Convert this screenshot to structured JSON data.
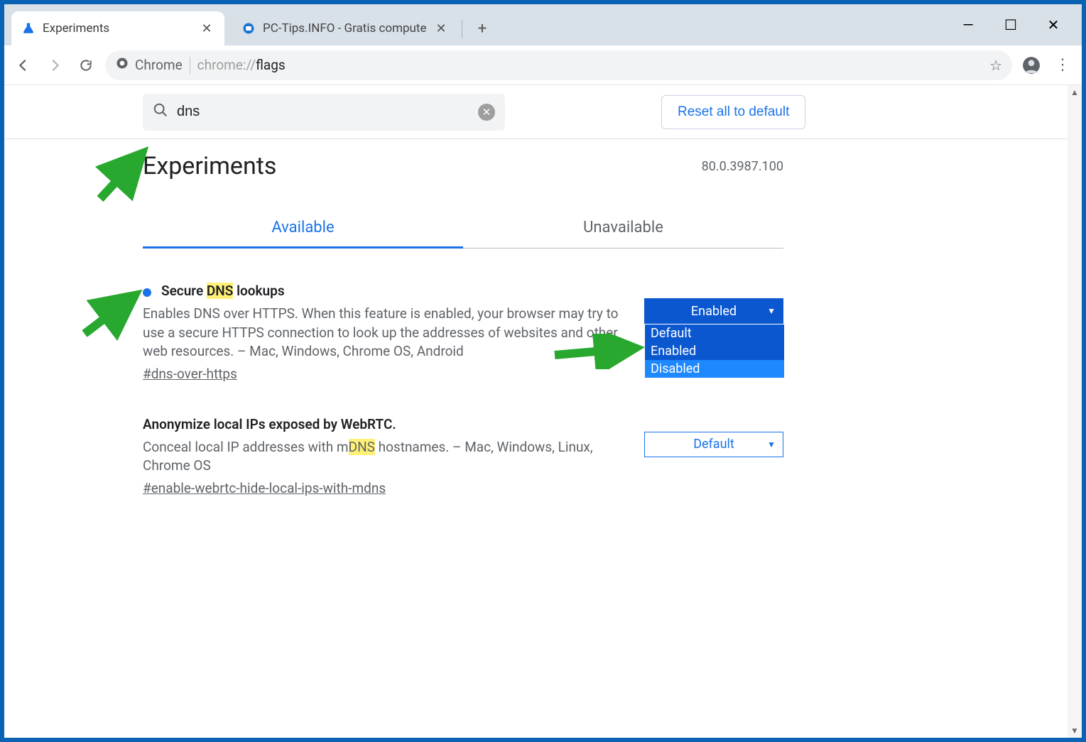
{
  "window": {
    "minimize_tip": "Minimize",
    "maximize_tip": "Maximize",
    "close_tip": "Close"
  },
  "tabs": [
    {
      "title": "Experiments",
      "active": true
    },
    {
      "title": "PC-Tips.INFO - Gratis computer t",
      "active": false
    }
  ],
  "toolbar": {
    "chip_label": "Chrome",
    "url_prefix": "chrome://",
    "url_suffix": "flags"
  },
  "flags": {
    "search_value": "dns",
    "reset_label": "Reset all to default",
    "heading": "Experiments",
    "version": "80.0.3987.100",
    "tab_available": "Available",
    "tab_unavailable": "Unavailable",
    "dropdown_options": {
      "default": "Default",
      "enabled": "Enabled",
      "disabled": "Disabled"
    },
    "items": [
      {
        "title_pre": "Secure ",
        "title_hl": "DNS",
        "title_post": " lookups",
        "dot": true,
        "desc": "Enables DNS over HTTPS. When this feature is enabled, your browser may try to use a secure HTTPS connection to look up the addresses of websites and other web resources. – Mac, Windows, Chrome OS, Android",
        "anchor": "#dns-over-https",
        "select": "Enabled",
        "open": true
      },
      {
        "title_pre": "Anonymize local IPs exposed by WebRTC.",
        "title_hl": "",
        "title_post": "",
        "dot": false,
        "desc_pre": "Conceal local IP addresses with m",
        "desc_hl": "DNS",
        "desc_post": " hostnames. – Mac, Windows, Linux, Chrome OS",
        "anchor": "#enable-webrtc-hide-local-ips-with-mdns",
        "select": "Default",
        "open": false
      }
    ]
  }
}
